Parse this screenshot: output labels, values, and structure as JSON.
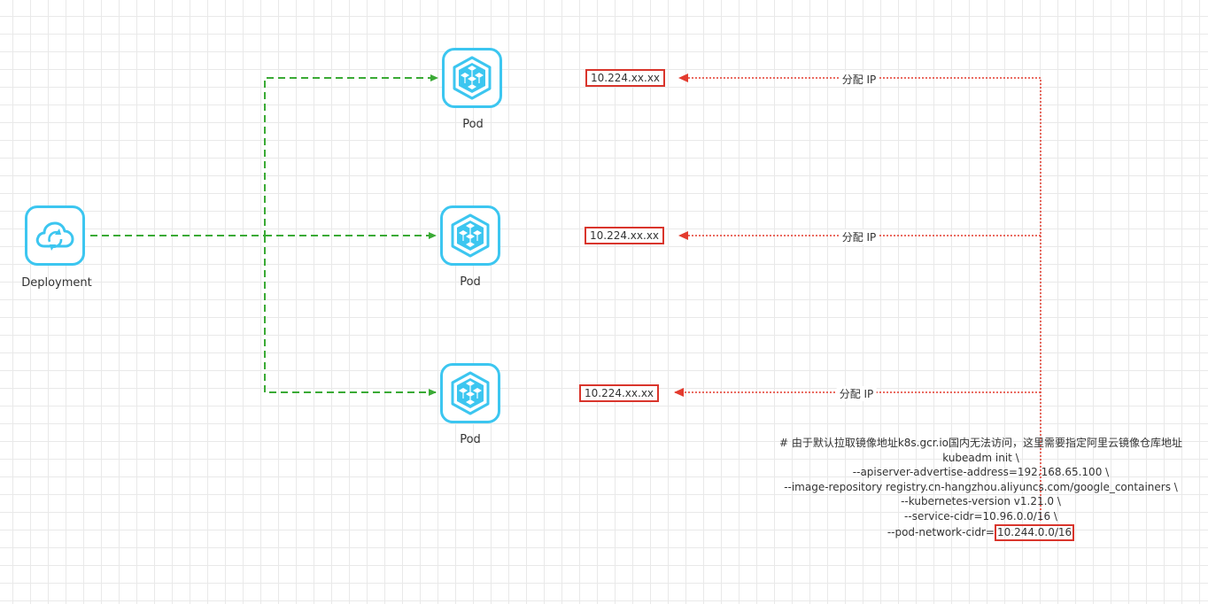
{
  "deployment": {
    "label": "Deployment",
    "icon": "cloud-sync-icon"
  },
  "pods": [
    {
      "label": "Pod",
      "ip": "10.224.xx.xx",
      "assign_label": "分配 IP",
      "icon": "cube-cluster-icon"
    },
    {
      "label": "Pod",
      "ip": "10.224.xx.xx",
      "assign_label": "分配 IP",
      "icon": "cube-cluster-icon"
    },
    {
      "label": "Pod",
      "ip": "10.224.xx.xx",
      "assign_label": "分配 IP",
      "icon": "cube-cluster-icon"
    }
  ],
  "command": {
    "comment": "# 由于默认拉取镜像地址k8s.gcr.io国内无法访问，这里需要指定阿里云镜像仓库地址",
    "lines": [
      "kubeadm init \\",
      "--apiserver-advertise-address=192.168.65.100 \\",
      "--image-repository registry.cn-hangzhou.aliyuncs.com/google_containers \\",
      "--kubernetes-version v1.21.0 \\",
      "--service-cidr=10.96.0.0/16 \\"
    ],
    "pod_cidr_prefix": "--pod-network-cidr=",
    "pod_cidr_value": "10.244.0.0/16"
  },
  "colors": {
    "icon_stroke": "#3cc6f0",
    "deployment_edge": "#3aaa35",
    "ip_edge": "#e33b2e",
    "highlight_box": "#d9352c"
  }
}
